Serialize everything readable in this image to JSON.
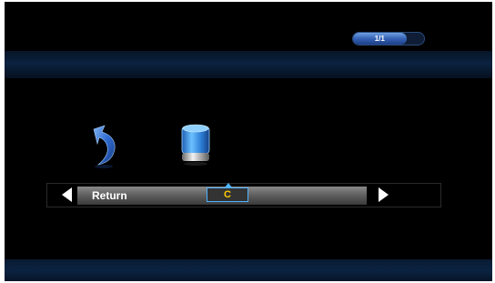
{
  "colors": {
    "background": "#000000",
    "accent": "#3562b5",
    "highlight_border": "#4fb3ff",
    "drive_letter": "#ffcc00"
  },
  "pager": {
    "text": "1/1",
    "progress": 0.75
  },
  "items": [
    {
      "label": "Return",
      "icon": "return-arrow-icon"
    },
    {
      "label": "C",
      "icon": "hard-drive-icon"
    }
  ],
  "nav": {
    "left_icon": "left-arrow-icon",
    "right_icon": "right-arrow-icon"
  }
}
